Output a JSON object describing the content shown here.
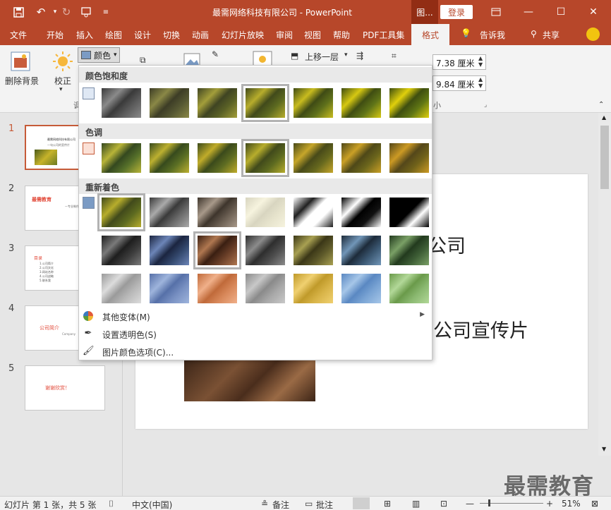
{
  "app": {
    "title": "最需网络科技有限公司  -  PowerPoint",
    "tool_tab": "图...",
    "login": "登录"
  },
  "ribbon_tabs": [
    "文件",
    "开始",
    "插入",
    "绘图",
    "设计",
    "切换",
    "动画",
    "幻灯片放映",
    "审阅",
    "视图",
    "帮助",
    "PDF工具集",
    "格式",
    "告诉我",
    "共享"
  ],
  "ribbon": {
    "remove_bg": "删除背景",
    "correct": "校正",
    "color": "颜色",
    "bring_forward": "上移一层",
    "height": "7.38 厘米",
    "width": "9.84 厘米",
    "size_group": "小"
  },
  "dropdown": {
    "saturation_title": "颜色饱和度",
    "tone_title": "色调",
    "recolor_title": "重新着色",
    "more_variations": "其他变体(M)",
    "set_transparent": "设置透明色(S)",
    "color_options": "图片颜色选项(C)..."
  },
  "slides": [
    {
      "num": "1",
      "title": "最需网络科技有限公司",
      "subtitle": "一句公司的宣传片"
    },
    {
      "num": "2",
      "title": "最需教育",
      "subtitle": "一专业制作"
    },
    {
      "num": "3",
      "title": "目录",
      "items": [
        "1.公司简介",
        "2.公司文化",
        "3.网站名称",
        "4.公司战略",
        "5.联系我"
      ]
    },
    {
      "num": "4",
      "title": "公司简介",
      "subtitle": "Company"
    },
    {
      "num": "5",
      "title": "谢谢欣赏！"
    }
  ],
  "main_slide": {
    "line1": "公司",
    "line2": "公司宣传片"
  },
  "status": {
    "slide_info": "幻灯片 第 1 张，共 5 张",
    "language": "中文(中国)",
    "notes": "备注",
    "comments": "批注",
    "zoom": "51%"
  },
  "watermark": "最需教育",
  "colors": {
    "accent": "#b7472a",
    "selected_thumb": "#c65b38"
  }
}
